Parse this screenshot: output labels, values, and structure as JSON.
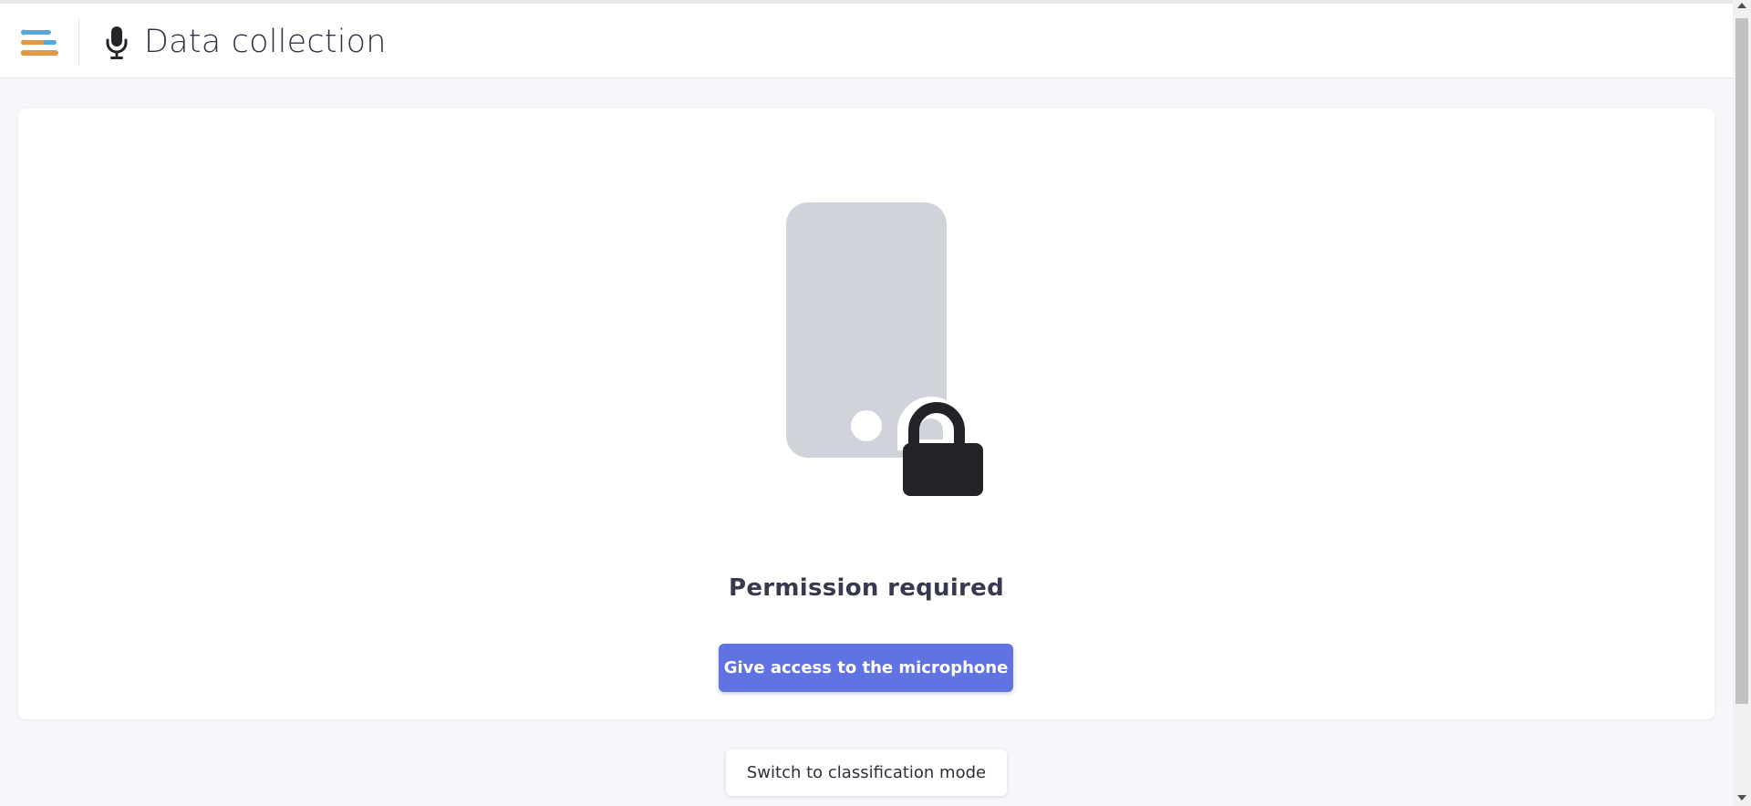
{
  "header": {
    "title": "Data collection",
    "logo_icon": "layered-bars-logo-icon",
    "mic_icon": "microphone-icon"
  },
  "main": {
    "illustration_icon": "phone-lock-icon",
    "permission_title": "Permission required",
    "grant_button_label": "Give access to the microphone"
  },
  "footer": {
    "switch_mode_label": "Switch to classification mode"
  },
  "colors": {
    "primary": "#6173e3",
    "logo_blue": "#5aa6db",
    "logo_orange": "#e09a45",
    "phone_gray": "#d0d4da",
    "lock_dark": "#222327"
  }
}
